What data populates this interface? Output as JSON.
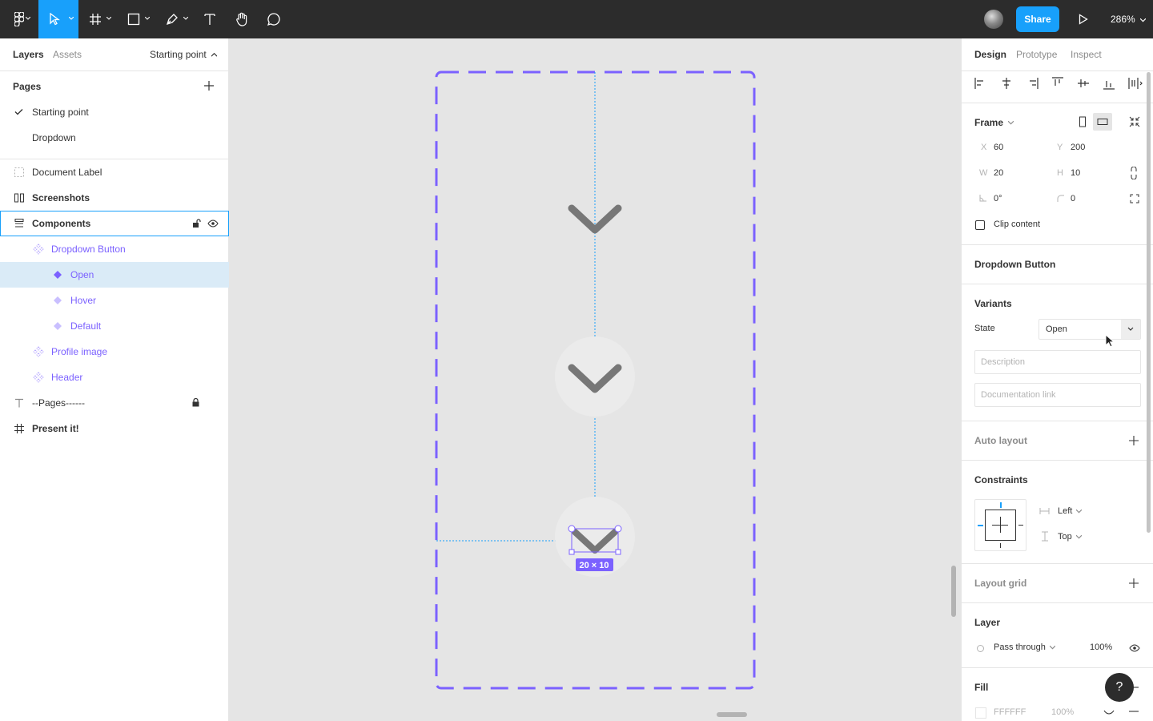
{
  "toolbar": {
    "share_label": "Share",
    "zoom": "286%",
    "tools": [
      "main-menu",
      "move",
      "frame",
      "shape",
      "pen",
      "text",
      "hand",
      "comment"
    ]
  },
  "left_panel": {
    "tabs": {
      "layers": "Layers",
      "assets": "Assets"
    },
    "current_page": "Starting point",
    "pages_title": "Pages",
    "pages": [
      {
        "label": "Starting point",
        "checked": true
      },
      {
        "label": "Dropdown",
        "checked": false
      }
    ],
    "layers": [
      {
        "label": "Document Label",
        "indent": 0,
        "icon": "dashed-frame-icon"
      },
      {
        "label": "Screenshots",
        "indent": 0,
        "icon": "columns-frame-icon",
        "bold": true
      },
      {
        "label": "Components",
        "indent": 0,
        "icon": "rows-frame-icon",
        "bold": true,
        "outlined": true
      },
      {
        "label": "Dropdown Button",
        "indent": 1,
        "icon": "component-set-icon",
        "purple": true
      },
      {
        "label": "Open",
        "indent": 2,
        "icon": "variant-icon",
        "purple": true,
        "selected": true
      },
      {
        "label": "Hover",
        "indent": 2,
        "icon": "variant-icon",
        "purple": true
      },
      {
        "label": "Default",
        "indent": 2,
        "icon": "variant-icon",
        "purple": true
      },
      {
        "label": "Profile image",
        "indent": 1,
        "icon": "component-set-icon",
        "purple": true
      },
      {
        "label": "Header",
        "indent": 1,
        "icon": "component-set-icon",
        "purple": true
      },
      {
        "label": "--Pages------",
        "indent": 0,
        "icon": "text-icon",
        "locked": true
      },
      {
        "label": "Present it!",
        "indent": 0,
        "icon": "frame-icon",
        "bold": true
      }
    ]
  },
  "canvas": {
    "selection_size": "20 × 10",
    "colors": {
      "frame_border": "#7b61ff",
      "chevron": "#777777",
      "guide": "#18a0fb"
    }
  },
  "right_panel": {
    "tabs": {
      "design": "Design",
      "prototype": "Prototype",
      "inspect": "Inspect"
    },
    "frame": {
      "title": "Frame",
      "x_label": "X",
      "x": "60",
      "y_label": "Y",
      "y": "200",
      "w_label": "W",
      "w": "20",
      "h_label": "H",
      "h": "10",
      "rotation": "0°",
      "radius": "0",
      "clip_content": "Clip content"
    },
    "component_name": "Dropdown Button",
    "variants": {
      "title": "Variants",
      "state_label": "State",
      "state_value": "Open",
      "description_placeholder": "Description",
      "doc_link_placeholder": "Documentation link"
    },
    "auto_layout": "Auto layout",
    "constraints": {
      "title": "Constraints",
      "horizontal": "Left",
      "vertical": "Top"
    },
    "layout_grid": "Layout grid",
    "layer": {
      "title": "Layer",
      "blend": "Pass through",
      "opacity": "100%"
    },
    "fill": {
      "title": "Fill",
      "hex": "FFFFFF",
      "opacity": "100%"
    }
  },
  "help_label": "?"
}
